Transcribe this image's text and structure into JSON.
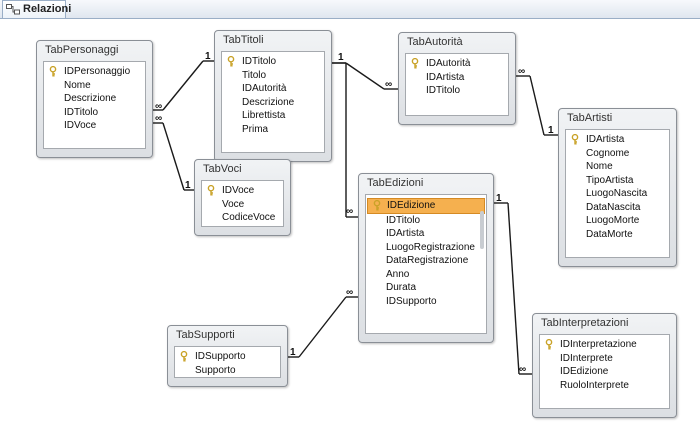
{
  "tab": {
    "title": "Relazioni"
  },
  "tables": {
    "personaggi": {
      "title": "TabPersonaggi",
      "fields": [
        {
          "name": "IDPersonaggio",
          "key": true
        },
        {
          "name": "Nome"
        },
        {
          "name": "Descrizione"
        },
        {
          "name": "IDTitolo"
        },
        {
          "name": "IDVoce"
        }
      ]
    },
    "titoli": {
      "title": "TabTitoli",
      "fields": [
        {
          "name": "IDTitolo",
          "key": true
        },
        {
          "name": "Titolo"
        },
        {
          "name": "IDAutorità"
        },
        {
          "name": "Descrizione"
        },
        {
          "name": "Librettista"
        },
        {
          "name": "Prima"
        }
      ]
    },
    "autorita": {
      "title": "TabAutorità",
      "fields": [
        {
          "name": "IDAutorità",
          "key": true
        },
        {
          "name": "IDArtista"
        },
        {
          "name": "IDTitolo"
        }
      ]
    },
    "artisti": {
      "title": "TabArtisti",
      "fields": [
        {
          "name": "IDArtista",
          "key": true
        },
        {
          "name": "Cognome"
        },
        {
          "name": "Nome"
        },
        {
          "name": "TipoArtista"
        },
        {
          "name": "LuogoNascita"
        },
        {
          "name": "DataNascita"
        },
        {
          "name": "LuogoMorte"
        },
        {
          "name": "DataMorte"
        }
      ]
    },
    "voci": {
      "title": "TabVoci",
      "fields": [
        {
          "name": "IDVoce",
          "key": true
        },
        {
          "name": "Voce"
        },
        {
          "name": "CodiceVoce"
        }
      ]
    },
    "edizioni": {
      "title": "TabEdizioni",
      "fields": [
        {
          "name": "IDEdizione",
          "key": true,
          "selected": true
        },
        {
          "name": "IDTitolo"
        },
        {
          "name": "IDArtista"
        },
        {
          "name": "LuogoRegistrazione"
        },
        {
          "name": "DataRegistrazione"
        },
        {
          "name": "Anno"
        },
        {
          "name": "Durata"
        },
        {
          "name": "IDSupporto"
        }
      ]
    },
    "supporti": {
      "title": "TabSupporti",
      "fields": [
        {
          "name": "IDSupporto",
          "key": true
        },
        {
          "name": "Supporto"
        }
      ]
    },
    "interpretazioni": {
      "title": "TabInterpretazioni",
      "fields": [
        {
          "name": "IDInterpretazione",
          "key": true
        },
        {
          "name": "IDInterprete"
        },
        {
          "name": "IDEdizione"
        },
        {
          "name": "RuoloInterprete"
        }
      ]
    }
  },
  "relationships": [
    {
      "one": "titoli",
      "many": "personaggi",
      "one_label": "1",
      "many_label": "∞"
    },
    {
      "one": "voci",
      "many": "personaggi",
      "one_label": "1",
      "many_label": "∞"
    },
    {
      "one": "titoli",
      "many": "autorita",
      "one_label": "1",
      "many_label": "∞"
    },
    {
      "one": "artisti",
      "many": "autorita",
      "one_label": "1",
      "many_label": "∞"
    },
    {
      "one": "titoli",
      "many": "edizioni",
      "one_label": "1",
      "many_label": "∞"
    },
    {
      "one": "supporti",
      "many": "edizioni",
      "one_label": "1",
      "many_label": "∞"
    },
    {
      "one": "edizioni",
      "many": "interpretazioni",
      "one_label": "1",
      "many_label": "∞"
    }
  ],
  "colors": {
    "selected_row": "#f5b04f",
    "key_icon": "#c9a227"
  }
}
